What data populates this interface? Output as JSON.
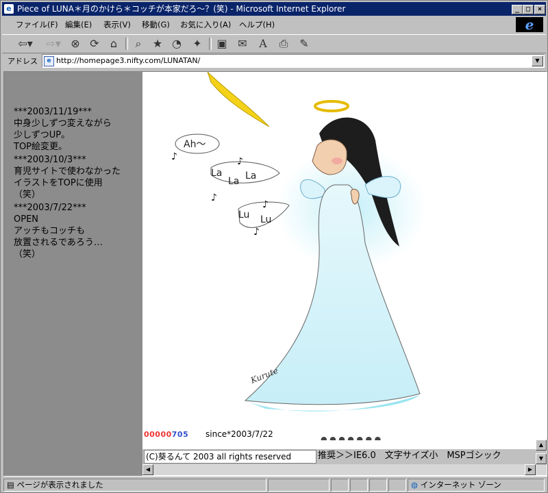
{
  "window": {
    "title": "Piece of LUNA＊月のかけら＊コッチが本家だろ～？(笑) - Microsoft Internet Explorer",
    "title_bar_color": "#0a246a"
  },
  "menubar": {
    "items": [
      "ファイル(F)",
      "編集(E)",
      "表示(V)",
      "移動(G)",
      "お気に入り(A)",
      "ヘルプ(H)"
    ]
  },
  "toolbar": {
    "icons": [
      "back-icon",
      "forward-icon",
      "stop-icon",
      "refresh-icon",
      "home-icon",
      "search-icon",
      "favorites-icon",
      "history-icon",
      "channels-icon",
      "fullscreen-icon",
      "mail-icon",
      "font-icon",
      "print-icon",
      "edit-icon"
    ]
  },
  "address": {
    "label": "アドレス",
    "url": "http://homepage3.nifty.com/LUNATAN/"
  },
  "news": [
    {
      "date": "***2003/11/19***",
      "lines": [
        "中身少しずつ変えながら",
        "少しずつUP。",
        "TOP絵変更。"
      ]
    },
    {
      "date": "***2003/10/3***",
      "lines": [
        "育児サイトで使わなかった",
        "イラストをTOPに使用",
        "（笑）"
      ]
    },
    {
      "date": "***2003/7/22***",
      "lines": [
        "OPEN",
        "アッチもコッチも",
        "放置されるであろう…",
        "（笑）"
      ]
    }
  ],
  "illustration": {
    "bubbles": [
      "Ah～",
      "La",
      "La",
      "La",
      "Lu",
      "Lu"
    ],
    "signature": "Kurute"
  },
  "counter": {
    "digits_red": "00000",
    "digits_mixed": "705",
    "since": "since*2003/7/22"
  },
  "footer": {
    "copyright": "(C)葵るんて 2003 all rights reserved",
    "recommend": "推奨＞＞IE6.0　文字サイズ小　MSPゴシック"
  },
  "status": {
    "message": "ページが表示されました",
    "zone": "インターネット ゾーン"
  },
  "colors": {
    "left_frame": "#8c8c8c",
    "counter_red": "#e33333",
    "counter_blue": "#2e4fcc"
  }
}
